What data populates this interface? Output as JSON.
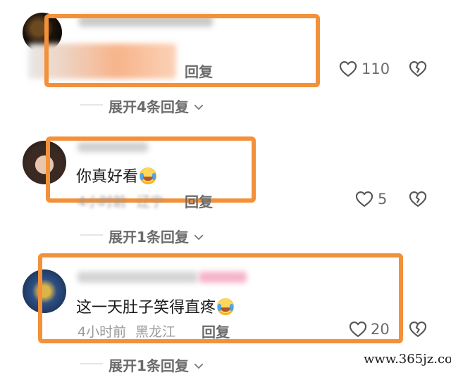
{
  "comments": [
    {
      "text": "",
      "meta_time": "",
      "meta_location": "",
      "reply_label": "回复",
      "like_count": "110",
      "expand_label": "展开4条回复"
    },
    {
      "text": "你真好看",
      "meta_time": "4小时前",
      "meta_location": "辽宁",
      "reply_label": "回复",
      "like_count": "5",
      "expand_label": "展开1条回复"
    },
    {
      "text": "这一天肚子笑得直疼",
      "meta_time": "4小时前",
      "meta_location": "黑龙江",
      "reply_label": "回复",
      "like_count": "20",
      "expand_label": "展开1条回复"
    }
  ],
  "watermark": "www.365jz.com",
  "icons": {
    "like": "heart-outline-icon",
    "dislike": "broken-heart-icon",
    "expand": "chevron-down-icon",
    "emoji": "laugh-cry-emoji"
  },
  "colors": {
    "highlight": "#f3913a",
    "muted": "#9a9a9a",
    "reply": "#6b6b6b"
  }
}
